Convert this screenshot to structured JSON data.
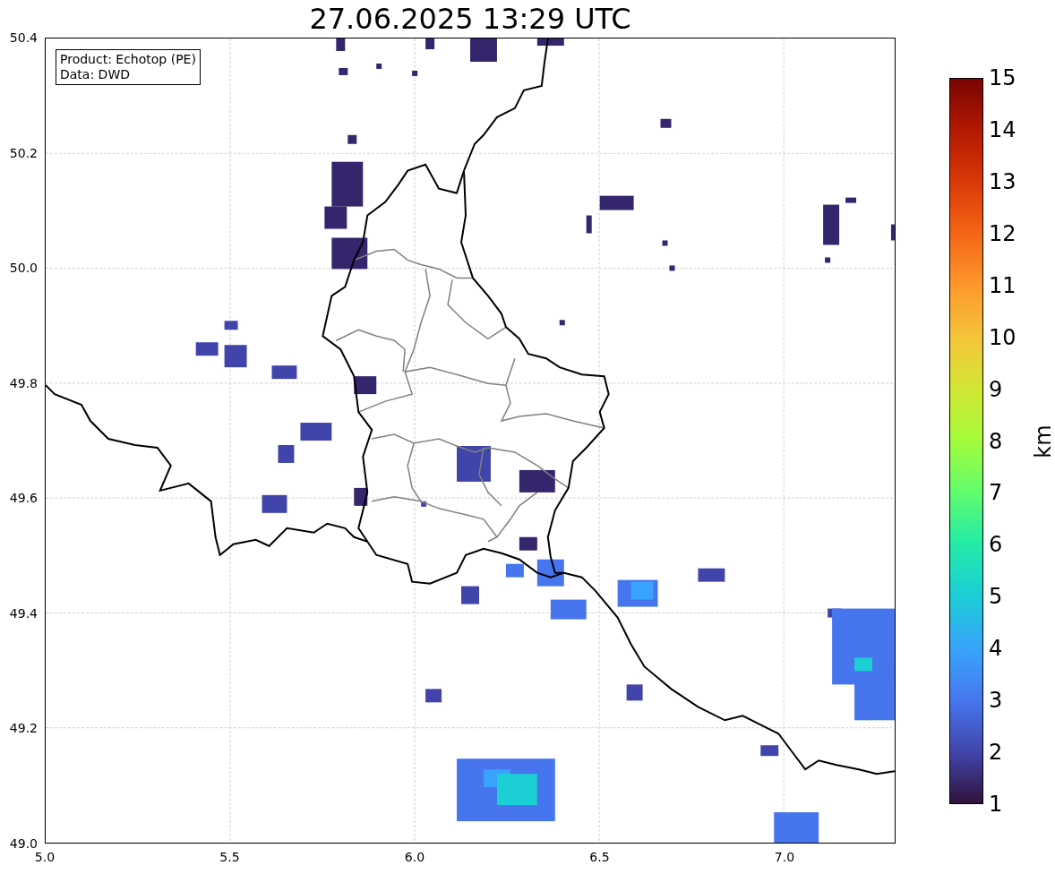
{
  "title": "27.06.2025 13:29 UTC",
  "info_box": [
    "Product: Echotop (PE)",
    "Data: DWD"
  ],
  "x_ticks": [
    "5.0",
    "5.5",
    "6.0",
    "6.5",
    "7.0"
  ],
  "y_ticks": [
    "50.4",
    "50.2",
    "50.0",
    "49.8",
    "49.6",
    "49.4",
    "49.2",
    "49.0"
  ],
  "colorbar": {
    "label": "km",
    "ticks": [
      "15",
      "14",
      "13",
      "12",
      "11",
      "10",
      "9",
      "8",
      "7",
      "6",
      "5",
      "4",
      "3",
      "2",
      "1"
    ]
  }
}
